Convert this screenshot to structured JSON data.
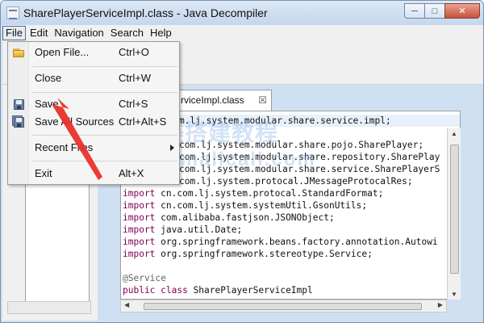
{
  "window": {
    "title": "SharePlayerServiceImpl.class - Java Decompiler",
    "minimize_icon": "minimize-icon",
    "maximize_icon": "maximize-icon",
    "close_icon": "close-icon"
  },
  "menubar": {
    "items": [
      "File",
      "Edit",
      "Navigation",
      "Search",
      "Help"
    ]
  },
  "file_menu": {
    "items": [
      {
        "label": "Open File...",
        "shortcut": "Ctrl+O",
        "icon": "folder-open-icon"
      },
      {
        "label": "Close",
        "shortcut": "Ctrl+W",
        "icon": ""
      },
      {
        "label": "Save",
        "shortcut": "Ctrl+S",
        "icon": "save-disk-icon"
      },
      {
        "label": "Save All Sources",
        "shortcut": "Ctrl+Alt+S",
        "icon": "save-all-icon"
      },
      {
        "label": "Recent Files",
        "shortcut": "",
        "icon": "submenu-arrow-icon"
      },
      {
        "label": "Exit",
        "shortcut": "Alt+X",
        "icon": ""
      }
    ]
  },
  "editor": {
    "tab_label": "rviceImpl.class",
    "tab_close": "☒",
    "lines": [
      {
        "kw": "",
        "text": "m.lj.system.modular.share.service.impl;"
      },
      {
        "kw": "",
        "text": ""
      },
      {
        "kw": "",
        "text": "com.lj.system.modular.share.pojo.SharePlayer;"
      },
      {
        "kw": "",
        "text": "com.lj.system.modular.share.repository.SharePlay"
      },
      {
        "kw": "",
        "text": "com.lj.system.modular.share.service.SharePlayerS"
      },
      {
        "kw": "",
        "text": "com.lj.system.protocal.JMessageProtocalRes;"
      },
      {
        "kw": "import",
        "text": " cn.com.lj.system.protocal.StandardFormat;"
      },
      {
        "kw": "import",
        "text": " cn.com.lj.system.systemUtil.GsonUtils;"
      },
      {
        "kw": "import",
        "text": " com.alibaba.fastjson.JSONObject;"
      },
      {
        "kw": "import",
        "text": " java.util.Date;"
      },
      {
        "kw": "import",
        "text": " org.springframework.beans.factory.annotation.Autowi"
      },
      {
        "kw": "import",
        "text": " org.springframework.stereotype.Service;"
      },
      {
        "kw": "",
        "text": ""
      },
      {
        "kw": "@Service",
        "text": ""
      },
      {
        "kw": "public class",
        "text": " SharePlayerServiceImpl"
      }
    ]
  },
  "watermark": {
    "line1": "智美搭建教程",
    "line2": "weimallcall.com"
  },
  "colors": {
    "keyword": "#7f0055",
    "annotation_arrow": "#e8322a",
    "title_bar": "#cfe0f2"
  }
}
